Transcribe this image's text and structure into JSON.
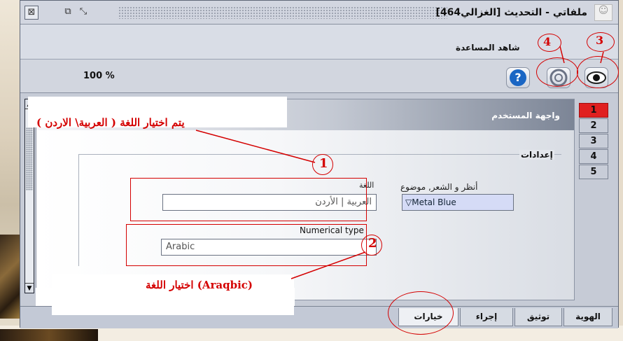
{
  "window": {
    "title": "ملفاتي - التحديث [الغزالي464]",
    "icon": "app-icon"
  },
  "menu": {
    "view": "شاهد",
    "help": "المساعدة"
  },
  "toolbar": {
    "zoom": "100 %",
    "help_icon": "?"
  },
  "panel": {
    "title": "واجهة المستخدم",
    "section": "إعدادات",
    "language_label": "اللغة",
    "language_value": "العربية | الأردن",
    "theme_label": "أنظر و الشعر, موضوع",
    "theme_value": "Metal Blue",
    "numerical_label": "Numerical type",
    "numerical_value": "Arabic"
  },
  "side_tabs": [
    "1",
    "2",
    "3",
    "4",
    "5"
  ],
  "bottom_tabs": [
    "الهوية",
    "توثيق",
    "إجراء",
    "خيارات"
  ],
  "annotations": {
    "text1": "يتم اختيار اللغة ( العربية\\ الاردن )",
    "text2": "اختيار اللغة (Araqbic)",
    "n1": "1",
    "n2": "2",
    "n3": "3",
    "n4": "4"
  },
  "colors": {
    "accent_red": "#d40000",
    "active_tab": "#e02020",
    "select_bg": "#d5dbf6"
  }
}
